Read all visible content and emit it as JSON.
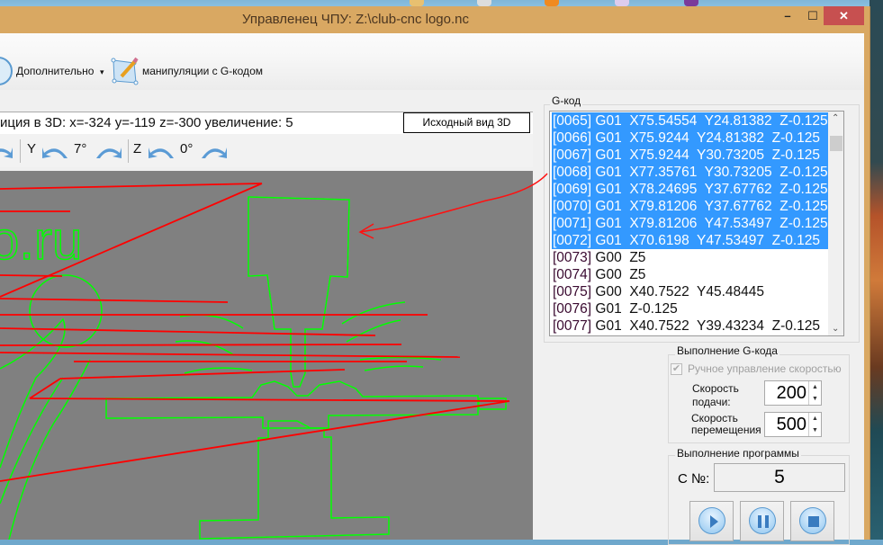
{
  "window": {
    "title": "Управленец ЧПУ: Z:\\club-cnc logo.nc",
    "close": "✕",
    "maximize": "☐",
    "minimize": "–"
  },
  "ribbon": {
    "extra_label": "Дополнительно",
    "extra_arrow": "▾",
    "gcode_tools_label": "манипуляции с G-кодом"
  },
  "view3d": {
    "status": "иция в 3D: x=-324 y=-119 z=-300 увеличение: 5",
    "reset_button": "Исходный вид 3D",
    "y_label": "Y",
    "y_angle": "7°",
    "z_label": "Z",
    "z_angle": "0°",
    "logo_fragment": "o.ru"
  },
  "gcode": {
    "title": "G-код",
    "lines": [
      {
        "num": "[0065]",
        "code": " G01  X75.54554  Y24.81382  Z-0.125",
        "selected": true
      },
      {
        "num": "[0066]",
        "code": " G01  X75.9244  Y24.81382  Z-0.125",
        "selected": true
      },
      {
        "num": "[0067]",
        "code": " G01  X75.9244  Y30.73205  Z-0.125",
        "selected": true
      },
      {
        "num": "[0068]",
        "code": " G01  X77.35761  Y30.73205  Z-0.125",
        "selected": true
      },
      {
        "num": "[0069]",
        "code": " G01  X78.24695  Y37.67762  Z-0.125",
        "selected": true
      },
      {
        "num": "[0070]",
        "code": " G01  X79.81206  Y37.67762  Z-0.125",
        "selected": true
      },
      {
        "num": "[0071]",
        "code": " G01  X79.81206  Y47.53497  Z-0.125",
        "selected": true
      },
      {
        "num": "[0072]",
        "code": " G01  X70.6198  Y47.53497  Z-0.125",
        "selected": true
      },
      {
        "num": "[0073]",
        "code": " G00  Z5",
        "selected": false
      },
      {
        "num": "[0074]",
        "code": " G00  Z5",
        "selected": false
      },
      {
        "num": "[0075]",
        "code": " G00  X40.7522  Y45.48445",
        "selected": false
      },
      {
        "num": "[0076]",
        "code": " G01  Z-0.125",
        "selected": false
      },
      {
        "num": "[0077]",
        "code": " G01  X40.7522  Y39.43234  Z-0.125",
        "selected": false
      }
    ]
  },
  "execution": {
    "title": "Выполнение G-кода",
    "manual_speed_label": "Ручное управление скоростью",
    "manual_speed_checked": true,
    "manual_speed_enabled": false,
    "feed_label_1": "Скорость",
    "feed_label_2": "подачи:",
    "feed_value": "200",
    "move_label_1": "Скорость",
    "move_label_2": "перемещения",
    "move_value": "500"
  },
  "program": {
    "title": "Выполнение программы",
    "line_label": "С №:",
    "line_value": "5",
    "play": "play-icon",
    "pause": "pause-icon",
    "stop": "stop-icon"
  },
  "colors": {
    "titlebar": "#d9a862",
    "selection": "#3399ff",
    "toolpath_cut": "#00ff00",
    "toolpath_rapid": "#ff0000",
    "canvas": "#808080",
    "close": "#c75050"
  }
}
